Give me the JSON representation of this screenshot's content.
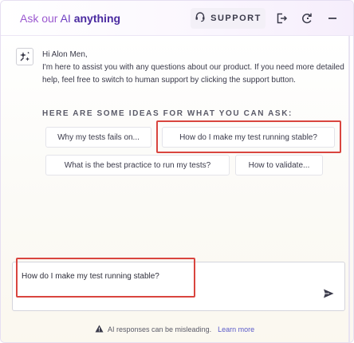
{
  "header": {
    "title_prefix": "Ask our ",
    "title_ai": "AI",
    "title_suffix": "anything",
    "support_label": "SUPPORT",
    "icons": [
      "headset-icon",
      "export-icon",
      "refresh-icon",
      "minimize-icon"
    ]
  },
  "message": {
    "avatar_icon": "ai-sparkle-icon",
    "greeting_line": "Hi Alon Men,",
    "body": "I'm here to assist you with any questions about our product. If you need more detailed help, feel free to switch to human support by clicking the support button."
  },
  "ideas": {
    "title": "HERE ARE SOME IDEAS FOR WHAT YOU CAN ASK:",
    "chips": [
      "Why my tests fails on...",
      "How do I make my test running stable?",
      "What is the best practice to run my tests?",
      "How to validate..."
    ]
  },
  "composer": {
    "value": "How do I make my test running stable?",
    "send_icon": "send-icon"
  },
  "footer": {
    "warning_icon": "warning-icon",
    "disclaimer": "AI responses can be misleading.",
    "link": "Learn more"
  },
  "colors": {
    "accent_purple": "#6f3fc2",
    "highlight_red": "#d9453f",
    "link_blue": "#5b5bc9"
  }
}
